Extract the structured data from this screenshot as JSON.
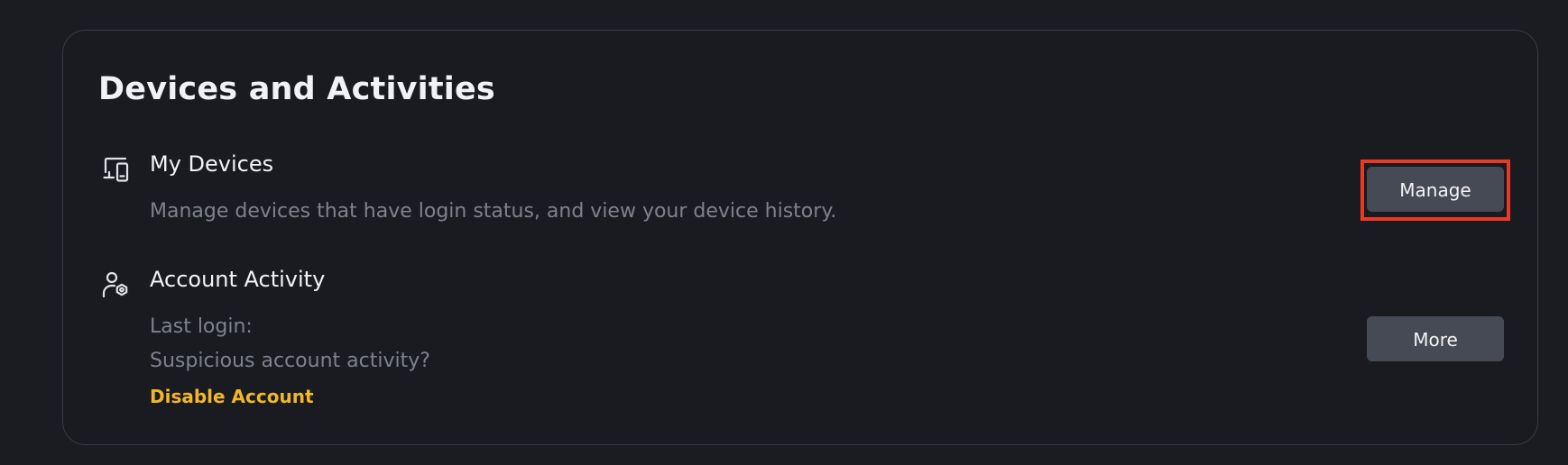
{
  "section": {
    "title": "Devices and Activities"
  },
  "devices": {
    "title": "My Devices",
    "description": "Manage devices that have login status, and view your device history.",
    "button_label": "Manage",
    "icon": "devices-icon"
  },
  "activity": {
    "title": "Account Activity",
    "last_login_label": "Last login:",
    "suspicious_label": "Suspicious account activity?",
    "disable_link": "Disable Account",
    "button_label": "More",
    "icon": "user-shield-icon"
  },
  "colors": {
    "background": "#1b1c22",
    "card_background": "#1a1b21",
    "card_border": "#3a3b42",
    "button_background": "#464a54",
    "accent_link": "#f2b728",
    "highlight_border": "#e83a25"
  }
}
